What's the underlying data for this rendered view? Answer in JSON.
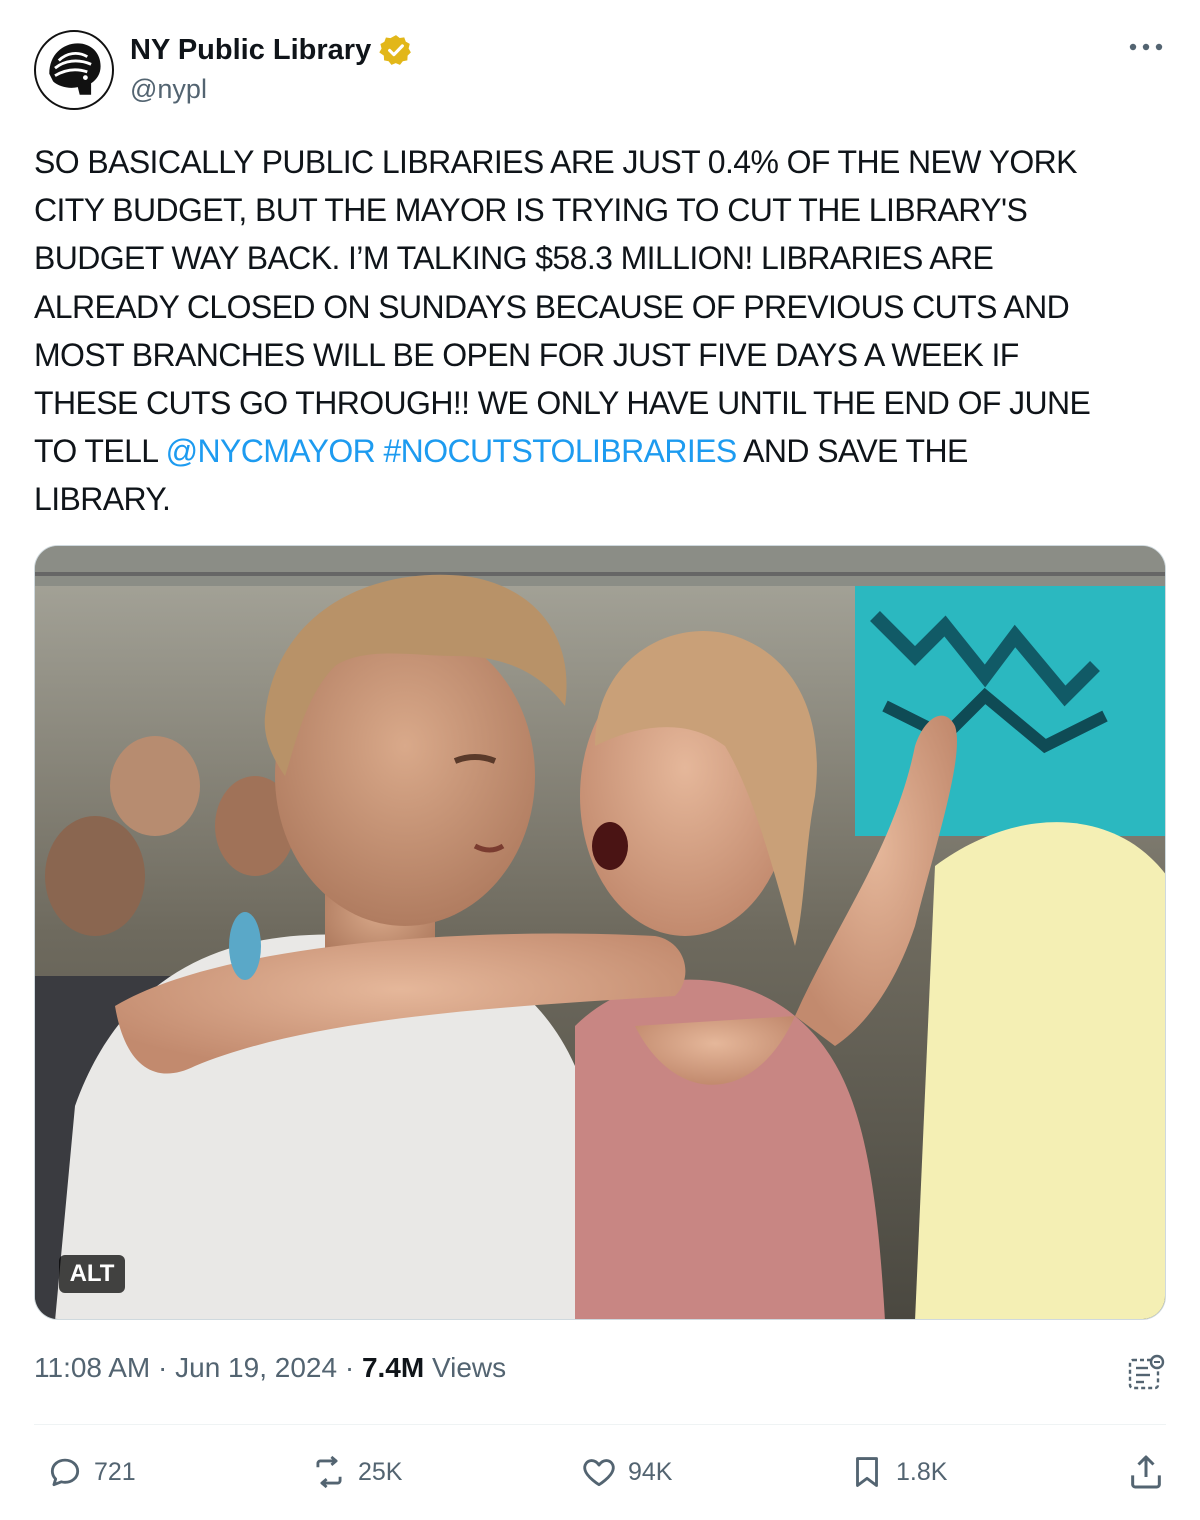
{
  "author": {
    "display_name": "NY Public Library",
    "handle": "@nypl",
    "verified": true,
    "verified_color": "#e2b719",
    "avatar_icon": "nypl-lion-logo"
  },
  "tweet": {
    "lines": [
      [
        {
          "text": "SO BASICALLY PUBLIC LIBRARIES ARE JUST 0.4% OF THE NEW YORK"
        }
      ],
      [
        {
          "text": "CITY BUDGET, BUT THE MAYOR IS TRYING TO CUT THE LIBRARY'S"
        }
      ],
      [
        {
          "text": "BUDGET WAY BACK. I’M TALKING $58.3  MILLION! LIBRARIES ARE"
        }
      ],
      [
        {
          "text": "ALREADY CLOSED ON SUNDAYS BECAUSE OF PREVIOUS CUTS AND"
        }
      ],
      [
        {
          "text": "MOST BRANCHES WILL  BE OPEN FOR JUST FIVE DAYS A WEEK IF"
        }
      ],
      [
        {
          "text": "THESE CUTS GO THROUGH!! WE ONLY HAVE UNTIL THE END OF JUNE"
        }
      ],
      [
        {
          "text": "TO TELL "
        },
        {
          "text": "@NYCMAYOR",
          "link": true
        },
        {
          "text": " "
        },
        {
          "text": "#NOCUTSTOLIBRARIES",
          "link": true
        },
        {
          "text": " AND SAVE THE"
        }
      ],
      [
        {
          "text": "LIBRARY."
        }
      ]
    ],
    "link_color": "#1d9bf0"
  },
  "media": {
    "alt_badge": "ALT"
  },
  "meta": {
    "time": "11:08 AM",
    "separator": " · ",
    "date": "Jun 19, 2024",
    "views_count": "7.4M",
    "views_label": " Views"
  },
  "actions": {
    "replies": "721",
    "reposts": "25K",
    "likes": "94K",
    "bookmarks": "1.8K"
  },
  "icons": [
    "more-icon",
    "verified-badge-icon",
    "analytics-icon",
    "reply-icon",
    "repost-icon",
    "like-icon",
    "bookmark-icon",
    "share-icon"
  ]
}
